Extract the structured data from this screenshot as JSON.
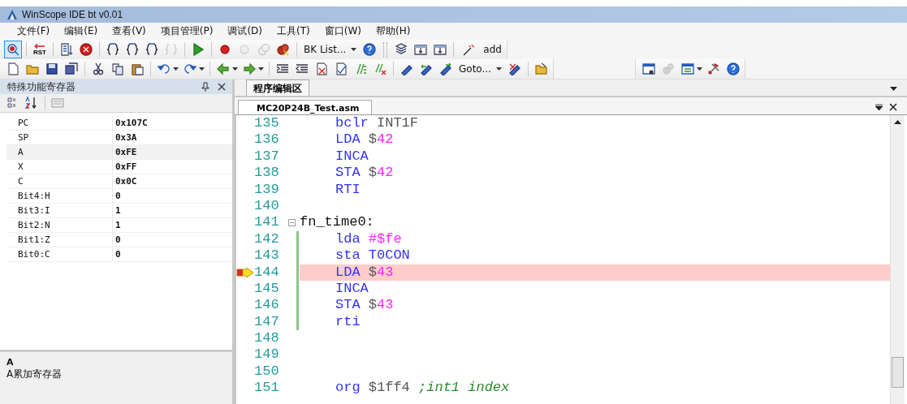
{
  "window": {
    "title": "WinScope IDE bt v0.01"
  },
  "menu": [
    {
      "label": "文件(F)"
    },
    {
      "label": "编辑(E)"
    },
    {
      "label": "查看(V)"
    },
    {
      "label": "项目管理(P)"
    },
    {
      "label": "调试(D)"
    },
    {
      "label": "工具(T)"
    },
    {
      "label": "窗口(W)"
    },
    {
      "label": "帮助(H)"
    }
  ],
  "toolbar_1": {
    "reset_label": "RST",
    "breakpoint_list": "BK List...",
    "add_button": "add"
  },
  "toolbar_2": {
    "goto": "Goto..."
  },
  "register_panel": {
    "title": "特殊功能寄存器",
    "rows": [
      {
        "name": "PC",
        "value": "0x107C",
        "selected": false
      },
      {
        "name": "SP",
        "value": "0x3A",
        "selected": false
      },
      {
        "name": "A",
        "value": "0xFE",
        "selected": true
      },
      {
        "name": "X",
        "value": "0xFF",
        "selected": false
      },
      {
        "name": "C",
        "value": "0x0C",
        "selected": false
      },
      {
        "name": "Bit4:H",
        "value": "0",
        "selected": false
      },
      {
        "name": "Bit3:I",
        "value": "1",
        "selected": false
      },
      {
        "name": "Bit2:N",
        "value": "1",
        "selected": false
      },
      {
        "name": "Bit1:Z",
        "value": "0",
        "selected": false
      },
      {
        "name": "Bit0:C",
        "value": "0",
        "selected": false
      }
    ],
    "description_title": "A",
    "description": "A累加寄存器"
  },
  "editor": {
    "panel_tab": "程序编辑区",
    "file_tab": "MC20P24B_Test.asm",
    "lines": [
      {
        "number": "135",
        "tokens": [
          {
            "kind": "keyword",
            "text": "bclr"
          },
          {
            "kind": "operand",
            "text": " INT1F"
          }
        ],
        "current": false,
        "changed": false
      },
      {
        "number": "136",
        "tokens": [
          {
            "kind": "keyword",
            "text": "LDA"
          },
          {
            "kind": "operand",
            "text": " $"
          },
          {
            "kind": "number",
            "text": "42"
          }
        ],
        "current": false,
        "changed": false
      },
      {
        "number": "137",
        "tokens": [
          {
            "kind": "keyword",
            "text": "INCA"
          }
        ],
        "current": false,
        "changed": false
      },
      {
        "number": "138",
        "tokens": [
          {
            "kind": "keyword",
            "text": "STA"
          },
          {
            "kind": "operand",
            "text": " $"
          },
          {
            "kind": "number",
            "text": "42"
          }
        ],
        "current": false,
        "changed": false
      },
      {
        "number": "139",
        "tokens": [
          {
            "kind": "keyword",
            "text": "RTI"
          }
        ],
        "current": false,
        "changed": false
      },
      {
        "number": "140",
        "current": false,
        "changed": false
      },
      {
        "number": "141",
        "tokens": [
          {
            "kind": "label",
            "text": "fn_time0:"
          }
        ],
        "current": false,
        "changed": false,
        "fold": {
          "expanded": true
        }
      },
      {
        "number": "142",
        "tokens": [
          {
            "kind": "keyword",
            "text": "lda"
          },
          {
            "kind": "number",
            "text": " #$fe"
          }
        ],
        "current": false,
        "changed": true
      },
      {
        "number": "143",
        "tokens": [
          {
            "kind": "keyword",
            "text": "sta"
          },
          {
            "kind": "keyword",
            "text": " T0CON"
          }
        ],
        "current": false,
        "changed": true
      },
      {
        "number": "144",
        "tokens": [
          {
            "kind": "keyword",
            "text": "LDA"
          },
          {
            "kind": "operand",
            "text": " $"
          },
          {
            "kind": "number",
            "text": "43"
          }
        ],
        "current": true,
        "changed": true
      },
      {
        "number": "145",
        "tokens": [
          {
            "kind": "keyword",
            "text": "INCA"
          }
        ],
        "current": false,
        "changed": true
      },
      {
        "number": "146",
        "tokens": [
          {
            "kind": "keyword",
            "text": "STA"
          },
          {
            "kind": "operand",
            "text": " $"
          },
          {
            "kind": "number",
            "text": "43"
          }
        ],
        "current": false,
        "changed": true
      },
      {
        "number": "147",
        "tokens": [
          {
            "kind": "keyword",
            "text": "rti"
          }
        ],
        "current": false,
        "changed": true
      },
      {
        "number": "148",
        "current": false,
        "changed": false
      },
      {
        "number": "149",
        "current": false,
        "changed": false
      },
      {
        "number": "150",
        "current": false,
        "changed": false
      },
      {
        "number": "151",
        "tokens": [
          {
            "kind": "keyword",
            "text": "org"
          },
          {
            "kind": "operand",
            "text": " $1ff4"
          },
          {
            "kind": "comment",
            "text": " ;int1 index"
          }
        ],
        "current": false,
        "changed": false
      }
    ]
  }
}
